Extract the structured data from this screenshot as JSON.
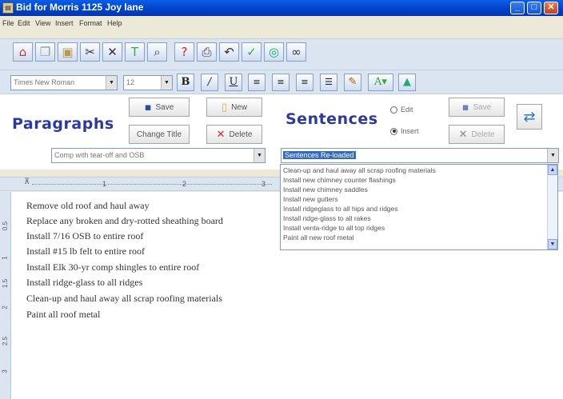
{
  "window": {
    "title": "Bid for Morris 1125 Joy lane"
  },
  "menu": [
    "File",
    "Edit",
    "View",
    "Insert",
    "Format",
    "Help"
  ],
  "toolbar": {
    "font_name": "Times New Roman",
    "font_size": "12"
  },
  "paragraphs": {
    "label": "Paragraphs",
    "save_label": "Save",
    "new_label": "New",
    "change_title_label": "Change Title",
    "delete_label": "Delete",
    "selected": "Comp with tear-off and OSB"
  },
  "sentences": {
    "label": "Sentences",
    "edit_label": "Edit",
    "insert_label": "Insert",
    "save_label": "Save",
    "delete_label": "Delete",
    "selected": "Sentences Re-loaded",
    "options": [
      "Clean-up and haul away all scrap roofing materials",
      "Install new chimney counter flashings",
      "Install new chimney saddles",
      "Install new gutters",
      "Install ridgeglass to all hips and ridges",
      "Install ridge-glass to all rakes",
      "Install venta-ridge to all top ridges",
      "Paint all new roof metal"
    ]
  },
  "ruler": {
    "numbers": [
      "1",
      "2",
      "3"
    ]
  },
  "vruler": {
    "numbers": [
      "0.5",
      "1",
      "1.5",
      "2",
      "2.5",
      "3"
    ]
  },
  "document": {
    "lines": [
      "Remove old roof and haul away",
      "Replace any broken and dry-rotted sheathing board",
      "Install 7/16 OSB to entire roof",
      "Install #15 lb felt to entire roof",
      "Install Elk 30-yr comp shingles to entire roof",
      "Install ridge-glass to all ridges",
      "Clean-up and haul away all scrap roofing materials",
      "Paint all roof metal"
    ]
  },
  "colors": {
    "title_bar": "#0040c8",
    "accent_label": "#2b3a9d",
    "toolbar_bg": "#dbe5f2",
    "selection": "#316ac5"
  }
}
